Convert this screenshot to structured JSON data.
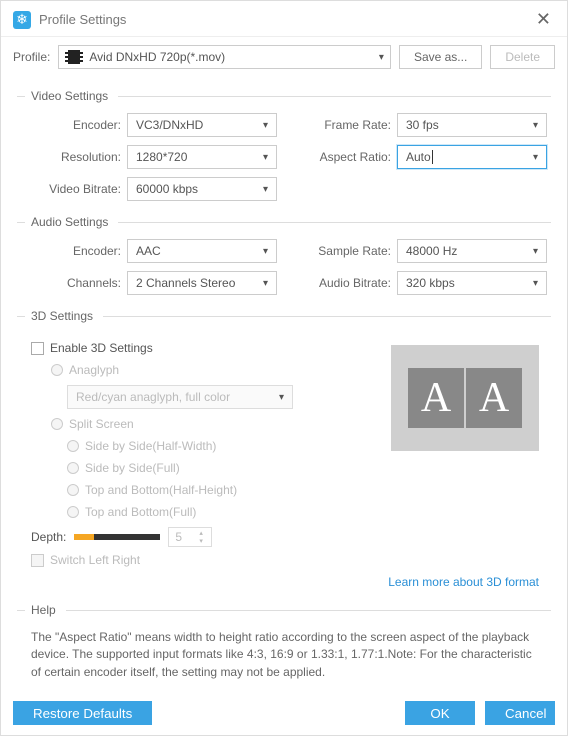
{
  "title": "Profile Settings",
  "close": "✕",
  "profile": {
    "label": "Profile:",
    "value": "Avid DNxHD 720p(*.mov)",
    "saveAs": "Save as...",
    "delete": "Delete"
  },
  "sections": {
    "video": "Video Settings",
    "audio": "Audio Settings",
    "threeD": "3D Settings",
    "help": "Help"
  },
  "video": {
    "encoderLabel": "Encoder:",
    "encoder": "VC3/DNxHD",
    "resolutionLabel": "Resolution:",
    "resolution": "1280*720",
    "bitrateLabel": "Video Bitrate:",
    "bitrate": "60000 kbps",
    "frameRateLabel": "Frame Rate:",
    "frameRate": "30 fps",
    "aspectLabel": "Aspect Ratio:",
    "aspect": "Auto"
  },
  "audio": {
    "encoderLabel": "Encoder:",
    "encoder": "AAC",
    "channelsLabel": "Channels:",
    "channels": "2 Channels Stereo",
    "sampleLabel": "Sample Rate:",
    "sample": "48000 Hz",
    "bitrateLabel": "Audio Bitrate:",
    "bitrate": "320 kbps"
  },
  "threeD": {
    "enable": "Enable 3D Settings",
    "anaglyph": "Anaglyph",
    "anaglyphMode": "Red/cyan anaglyph, full color",
    "split": "Split Screen",
    "sbsHalf": "Side by Side(Half-Width)",
    "sbsFull": "Side by Side(Full)",
    "tbHalf": "Top and Bottom(Half-Height)",
    "tbFull": "Top and Bottom(Full)",
    "depthLabel": "Depth:",
    "depthValue": "5",
    "switchLR": "Switch Left Right",
    "learnMore": "Learn more about 3D format"
  },
  "help": {
    "text": "The \"Aspect Ratio\" means width to height ratio according to the screen aspect of the playback device. The supported input formats like 4:3, 16:9 or 1.33:1, 1.77:1.Note: For the characteristic of certain encoder itself, the setting may not be applied."
  },
  "footer": {
    "restore": "Restore Defaults",
    "ok": "OK",
    "cancel": "Cancel"
  }
}
